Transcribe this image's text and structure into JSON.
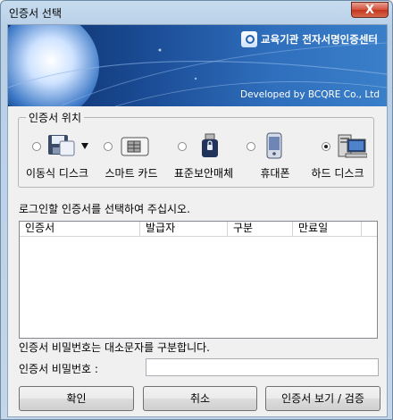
{
  "window": {
    "title": "인증서 선택",
    "close_label": "X"
  },
  "banner": {
    "brand": "교육기관 전자서명인증센터",
    "developer": "Developed by BCQRE Co., Ltd"
  },
  "location": {
    "legend": "인증서 위치",
    "items": [
      {
        "label": "이동식 디스크",
        "icon": "removable-disk-icon",
        "selected": false
      },
      {
        "label": "스마트 카드",
        "icon": "smart-card-icon",
        "selected": false
      },
      {
        "label": "표준보안매체",
        "icon": "security-token-icon",
        "selected": false
      },
      {
        "label": "휴대폰",
        "icon": "mobile-phone-icon",
        "selected": false
      },
      {
        "label": "하드 디스크",
        "icon": "hard-disk-icon",
        "selected": true
      }
    ]
  },
  "instruction": "로그인할 인증서를 선택하여 주십시오.",
  "table": {
    "columns": [
      "인증서",
      "발급자",
      "구분",
      "만료일"
    ],
    "rows": []
  },
  "notice": "인증서 비밀번호는 대소문자를 구분합니다.",
  "password": {
    "label": "인증서 비밀번호 :",
    "value": ""
  },
  "buttons": {
    "ok": "확인",
    "cancel": "취소",
    "view": "인증서 보기 / 검증"
  }
}
